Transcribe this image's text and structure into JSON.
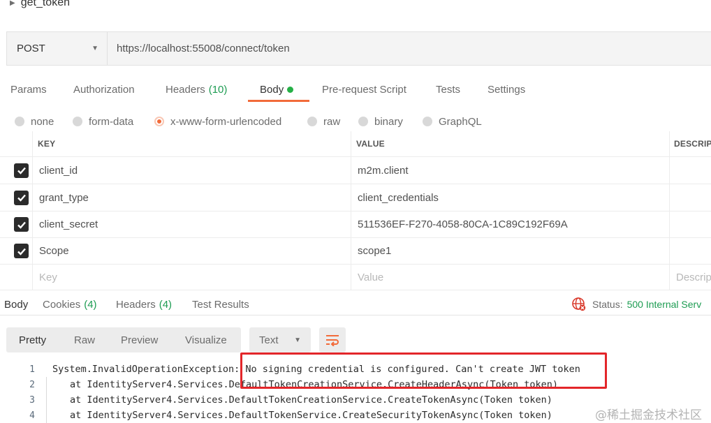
{
  "request": {
    "name": "get_token",
    "method": "POST",
    "url": "https://localhost:55008/connect/token"
  },
  "tabs": [
    {
      "label": "Params"
    },
    {
      "label": "Authorization"
    },
    {
      "label": "Headers",
      "count": "(10)"
    },
    {
      "label": "Body"
    },
    {
      "label": "Pre-request Script"
    },
    {
      "label": "Tests"
    },
    {
      "label": "Settings"
    }
  ],
  "body_types": [
    {
      "label": "none"
    },
    {
      "label": "form-data"
    },
    {
      "label": "x-www-form-urlencoded"
    },
    {
      "label": "raw"
    },
    {
      "label": "binary"
    },
    {
      "label": "GraphQL"
    }
  ],
  "selected_body_type": "x-www-form-urlencoded",
  "kv_table": {
    "headers": {
      "key": "KEY",
      "value": "VALUE",
      "description": "DESCRIP"
    },
    "rows": [
      {
        "key": "client_id",
        "value": "m2m.client",
        "checked": true
      },
      {
        "key": "grant_type",
        "value": "client_credentials",
        "checked": true
      },
      {
        "key": "client_secret",
        "value": "511536EF-F270-4058-80CA-1C89C192F69A",
        "checked": true
      },
      {
        "key": "Scope",
        "value": "scope1",
        "checked": true
      }
    ],
    "placeholders": {
      "key": "Key",
      "value": "Value",
      "description": "Descrip"
    }
  },
  "response": {
    "tabs": [
      {
        "label": "Body"
      },
      {
        "label": "Cookies",
        "count": "(4)"
      },
      {
        "label": "Headers",
        "count": "(4)"
      },
      {
        "label": "Test Results"
      }
    ],
    "status_label": "Status:",
    "status_value": "500 Internal Serv",
    "view_modes": [
      "Pretty",
      "Raw",
      "Preview",
      "Visualize"
    ],
    "format": "Text",
    "lines": [
      {
        "num": "1",
        "text": "System.InvalidOperationException: No signing credential is configured. Can't create JWT token"
      },
      {
        "num": "2",
        "text": "at IdentityServer4.Services.DefaultTokenCreationService.CreateHeaderAsync(Token token)"
      },
      {
        "num": "3",
        "text": "at IdentityServer4.Services.DefaultTokenCreationService.CreateTokenAsync(Token token)"
      },
      {
        "num": "4",
        "text": "at IdentityServer4.Services.DefaultTokenService.CreateSecurityTokenAsync(Token token)"
      }
    ]
  },
  "watermark": "@稀土掘金技术社区",
  "colors": {
    "accent": "#f26b3a",
    "success": "#1d9c52",
    "dot": "#26b047",
    "highlight_box": "#e3262a"
  }
}
